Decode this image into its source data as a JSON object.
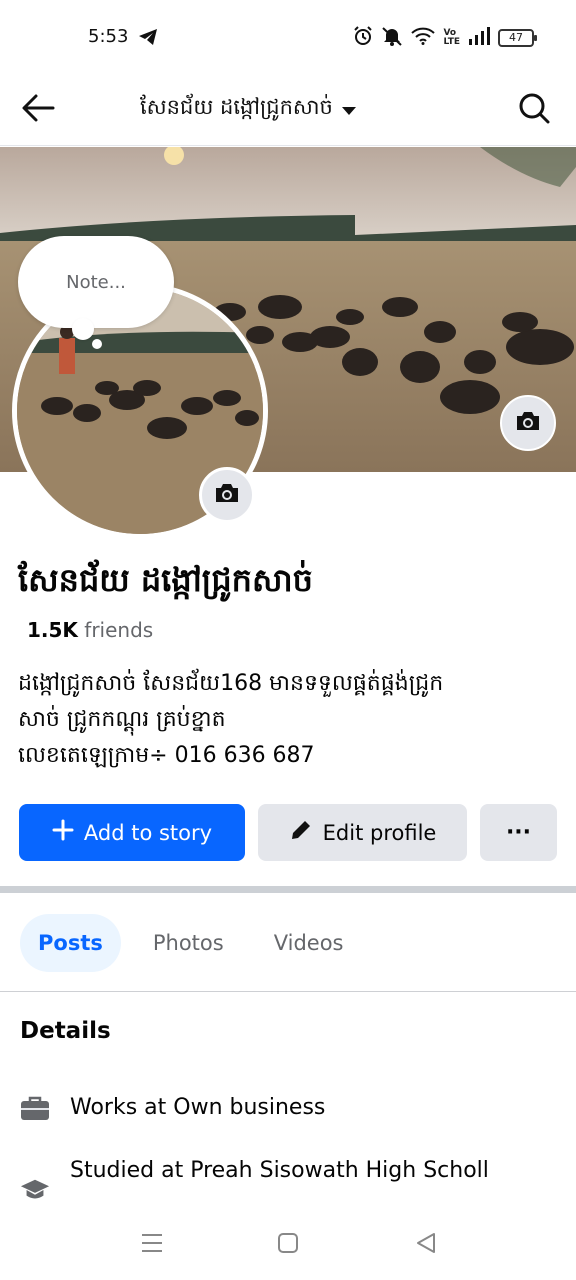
{
  "status_bar": {
    "time": "5:53",
    "volte_top": "Vo",
    "volte_bottom": "LTE",
    "battery": "47"
  },
  "header": {
    "title": "សែនជ័យ ដង្កៅជ្រូកសាច់"
  },
  "note": {
    "placeholder": "Note..."
  },
  "profile": {
    "name": "សែនជ័យ ដង្កៅជ្រូកសាច់",
    "friends_count": "1.5K",
    "friends_label": "friends",
    "bio_line1": "ដង្កៅជ្រូកសាច់ សែនជ័យ168 មានទទួលផ្គត់ផ្គង់ជ្រូក",
    "bio_line2": "សាច់ ជ្រូកកណ្ដុរ គ្រប់ខ្នាត",
    "bio_line3": "លេខតេឡេក្រាម÷ 016 636 687"
  },
  "actions": {
    "add_story": "Add to story",
    "edit_profile": "Edit profile",
    "more": "···"
  },
  "tabs": [
    {
      "label": "Posts",
      "active": true
    },
    {
      "label": "Photos",
      "active": false
    },
    {
      "label": "Videos",
      "active": false
    }
  ],
  "details": {
    "title": "Details",
    "work": "Works at Own business",
    "study": "Studied at Preah Sisowath High Scholl"
  },
  "colors": {
    "accent": "#0866ff",
    "button_gray": "#e4e6eb",
    "tab_active_bg": "#ebf5ff"
  }
}
